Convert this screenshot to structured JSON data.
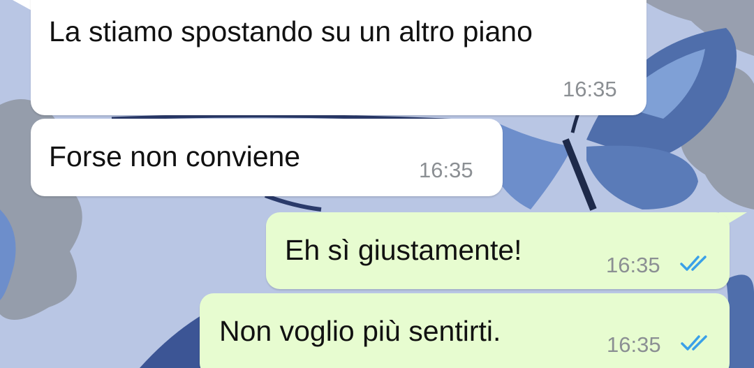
{
  "conversation": {
    "messages": [
      {
        "direction": "incoming",
        "text": "La stiamo spostando su un altro piano",
        "time": "16:35"
      },
      {
        "direction": "incoming",
        "text": "Forse non conviene",
        "time": "16:35"
      },
      {
        "direction": "outgoing",
        "text": "Eh sì giustamente!",
        "time": "16:35",
        "status_icon": "double-check-read-icon"
      },
      {
        "direction": "outgoing",
        "text": "Non voglio più sentirti.",
        "time": "16:35",
        "status_icon": "double-check-read-icon"
      }
    ]
  },
  "colors": {
    "incoming_bubble": "#ffffff",
    "outgoing_bubble": "#e7fcd0",
    "read_ticks": "#3aa0e8",
    "timestamp": "#8b8f93",
    "background": "#b9c6e4"
  },
  "wallpaper": {
    "subject": "blue butterflies"
  }
}
